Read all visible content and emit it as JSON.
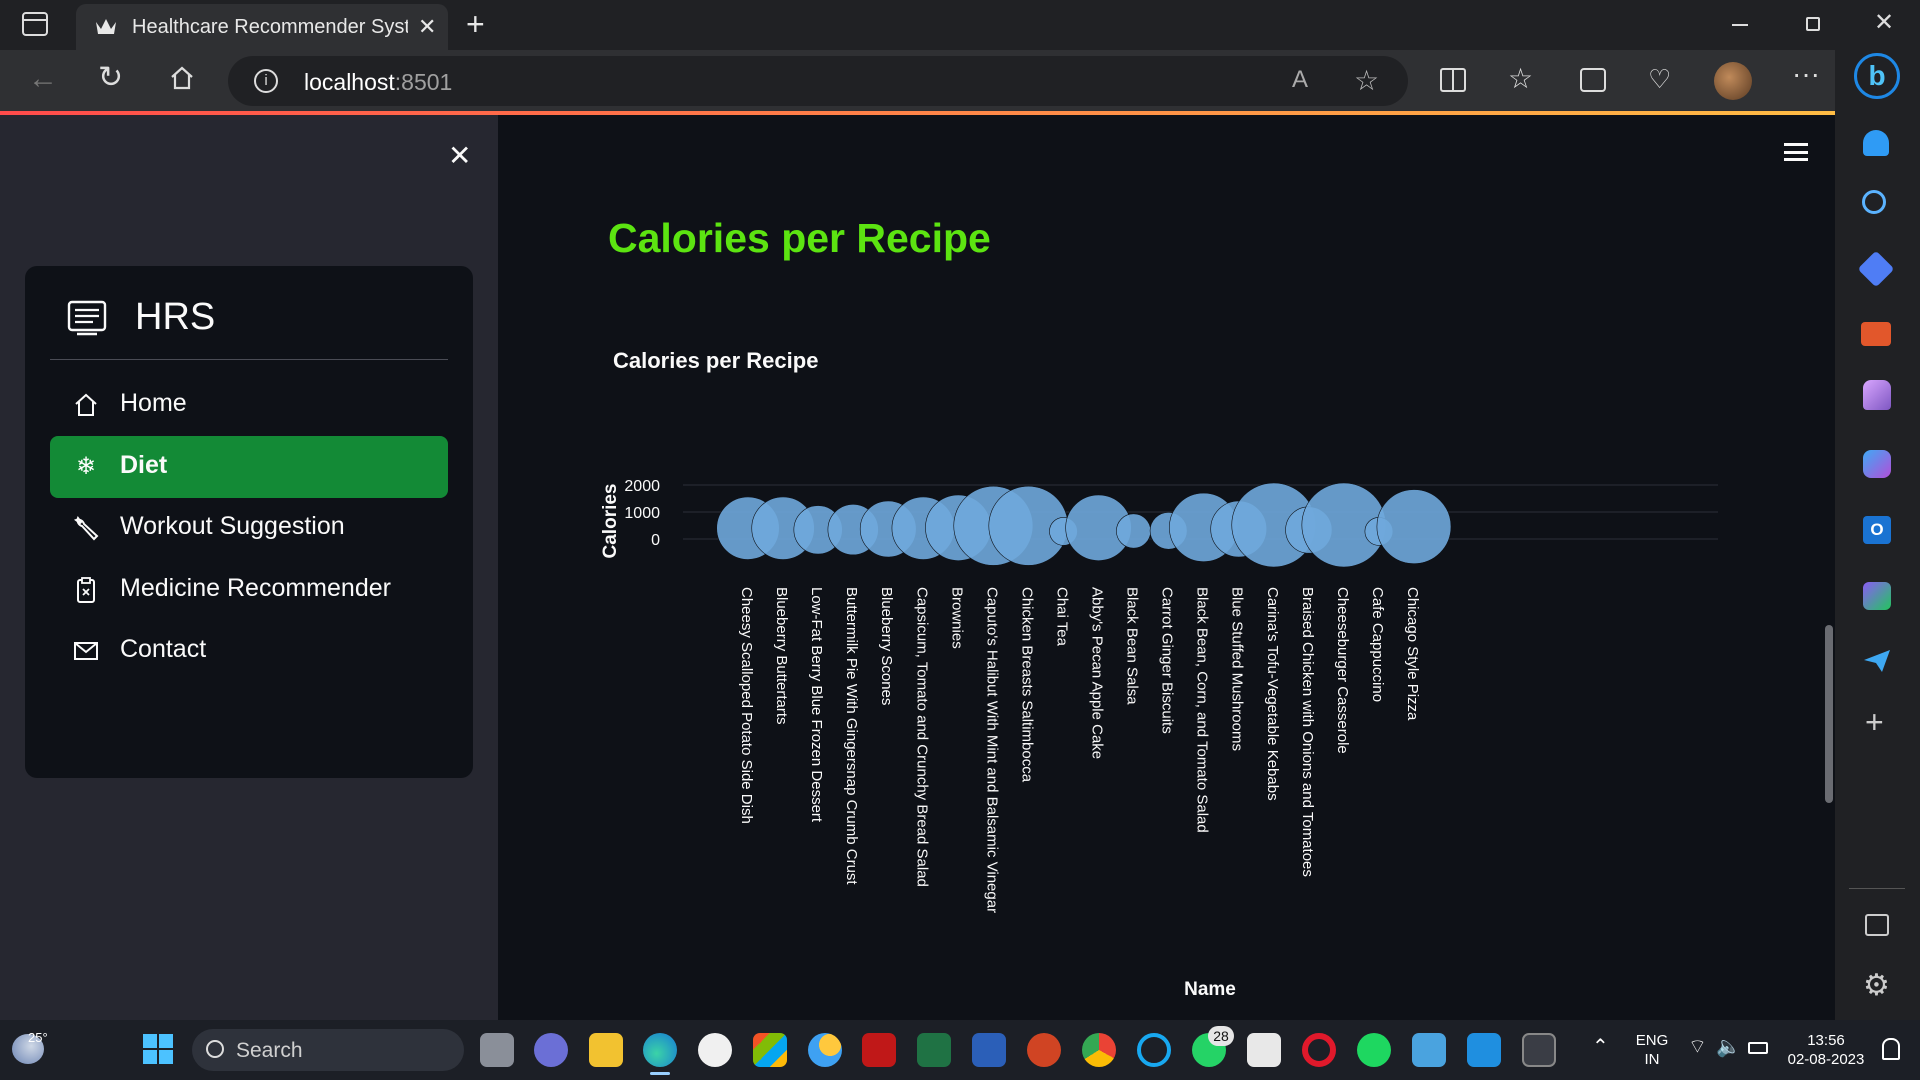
{
  "browser": {
    "tab_title": "Healthcare Recommender System",
    "url_host": "localhost",
    "url_port": ":8501"
  },
  "sidebar": {
    "brand": "HRS",
    "items": [
      {
        "label": "Home",
        "icon": "house-icon",
        "active": false
      },
      {
        "label": "Diet",
        "icon": "snowflake-icon",
        "active": true
      },
      {
        "label": "Workout Suggestion",
        "icon": "wrench-icon",
        "active": false
      },
      {
        "label": "Medicine Recommender",
        "icon": "clipboard-icon",
        "active": false
      },
      {
        "label": "Contact",
        "icon": "envelope-icon",
        "active": false
      }
    ],
    "accent_color": "#138a36"
  },
  "main": {
    "page_title": "Calories per Recipe",
    "title_color": "#5ce411"
  },
  "chart_data": {
    "type": "scatter",
    "title": "Calories per Recipe",
    "xlabel": "Name",
    "ylabel": "Calories",
    "ylim": [
      -400,
      2300
    ],
    "yticks": [
      0,
      1000,
      2000
    ],
    "grid": true,
    "marker": "bubble (size proportional to calories)",
    "color": "#6fa8dc",
    "categories": [
      "Cheesy Scalloped Potato Side Dish",
      "Blueberry Buttertarts",
      "Low-Fat Berry Blue Frozen Dessert",
      "Buttermilk Pie With Gingersnap Crumb Crust",
      "Blueberry Scones",
      "Capsicum, Tomato and Crunchy Bread Salad",
      "Brownies",
      "Caputo's Halibut With Mint and Balsamic Vinegar",
      "Chicken Breasts Saltimbocca",
      "Chai Tea",
      "Abby's Pecan Apple Cake",
      "Black Bean Salsa",
      "Carrot Ginger Biscuits",
      "Black Bean, Corn, and Tomato Salad",
      "Blue Stuffed Mushrooms",
      "Carina's Tofu-Vegetable Kebabs",
      "Braised Chicken with Onions and Tomatoes",
      "Cheeseburger Casserole",
      "Cafe Cappuccino",
      "Chicago Style Pizza"
    ],
    "values": [
      1000,
      1000,
      600,
      650,
      800,
      1000,
      1100,
      1600,
      1600,
      200,
      1100,
      300,
      350,
      1200,
      800,
      1800,
      550,
      1800,
      200,
      1400
    ]
  },
  "taskbar": {
    "weather": "25°",
    "search_label": "Search",
    "chat_badge": "28",
    "lang_top": "ENG",
    "lang_bottom": "IN",
    "time": "13:56",
    "date": "02-08-2023"
  }
}
